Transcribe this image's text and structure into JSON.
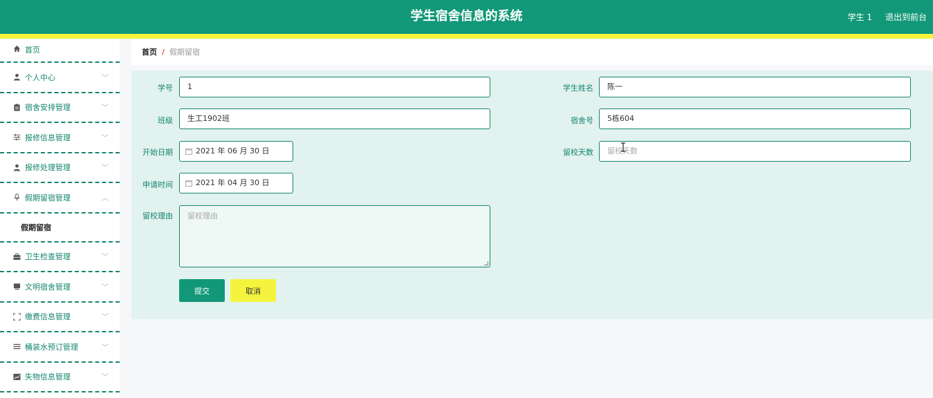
{
  "header": {
    "title": "学生宿舍信息的系统",
    "user": "学生 1",
    "logout": "退出到前台"
  },
  "sidebar": {
    "items": [
      {
        "label": "首页",
        "icon": "home-icon"
      },
      {
        "label": "个人中心",
        "icon": "user-icon"
      },
      {
        "label": "宿舍安排管理",
        "icon": "clipboard-icon"
      },
      {
        "label": "报修信息管理",
        "icon": "sliders-icon"
      },
      {
        "label": "报修处理管理",
        "icon": "user-icon"
      },
      {
        "label": "假期留宿管理",
        "icon": "microphone-icon"
      },
      {
        "label": "卫生检查管理",
        "icon": "briefcase-icon"
      },
      {
        "label": "文明宿舍管理",
        "icon": "monitor-icon"
      },
      {
        "label": "缴费信息管理",
        "icon": "fullscreen-icon"
      },
      {
        "label": "桶装水预订管理",
        "icon": "list-icon"
      },
      {
        "label": "失物信息管理",
        "icon": "chart-icon"
      }
    ],
    "subitem": "假期留宿"
  },
  "breadcrumb": {
    "home": "首页",
    "separator": "/",
    "current": "假期留宿"
  },
  "form": {
    "student_id_label": "学号",
    "student_id_value": "1",
    "student_name_label": "学生姓名",
    "student_name_value": "陈一",
    "class_label": "班级",
    "class_value": "生工1902班",
    "dorm_label": "宿舍号",
    "dorm_value": "5栋604",
    "start_date_label": "开始日期",
    "start_date_value": "2021 年 06 月 30 日",
    "days_label": "留校天数",
    "days_placeholder": "留校天数",
    "apply_time_label": "申请时间",
    "apply_time_value": "2021 年 04 月 30 日",
    "reason_label": "留校理由",
    "reason_placeholder": "留校理由",
    "submit": "提交",
    "cancel": "取消"
  },
  "colors": {
    "primary": "#129878",
    "accent": "#f4f43e",
    "form_bg": "#e2f2ef"
  }
}
